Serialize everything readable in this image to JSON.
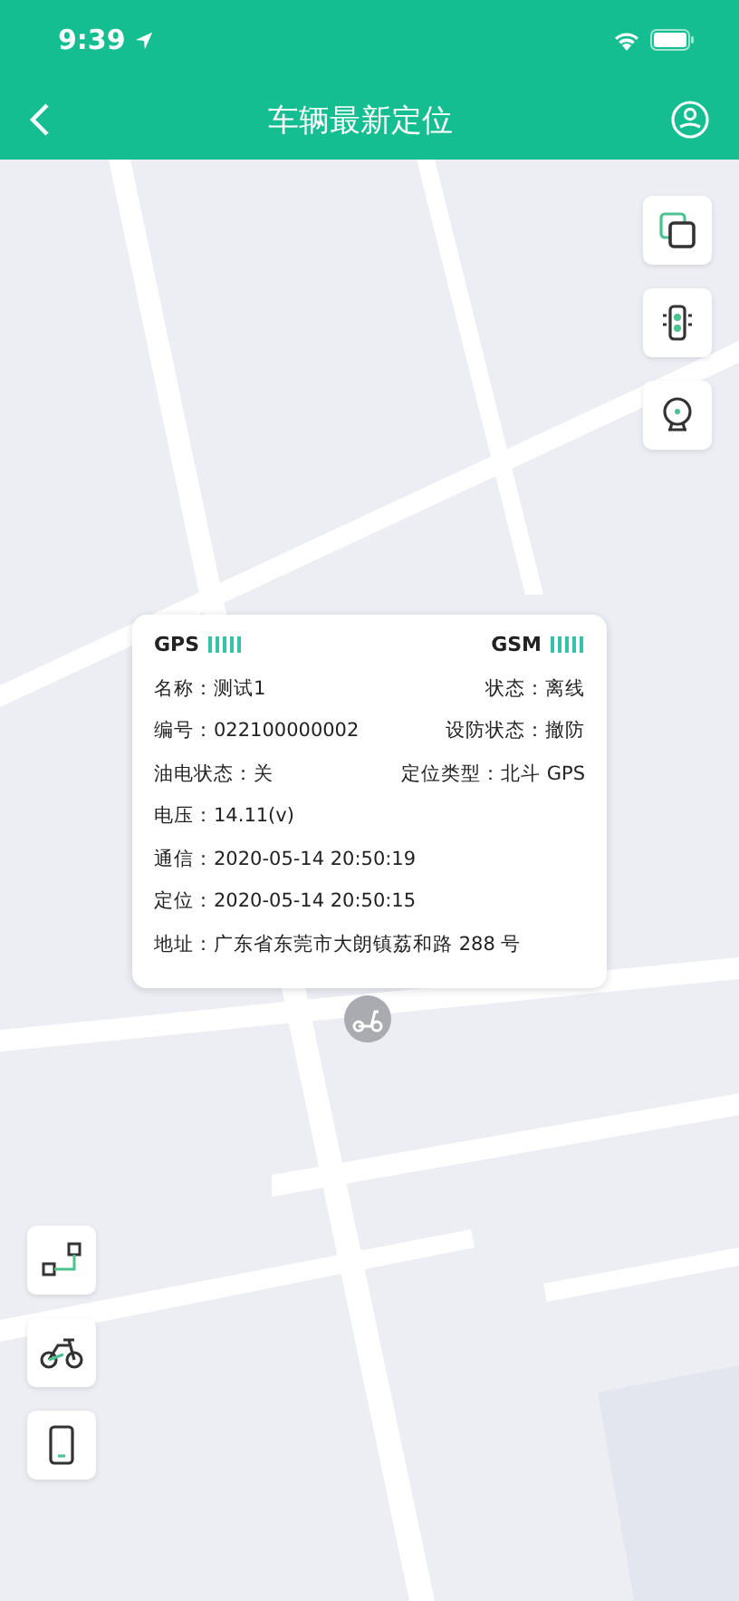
{
  "status_bar": {
    "time": "9:39"
  },
  "header": {
    "title": "车辆最新定位"
  },
  "info_card": {
    "gps_label": "GPS",
    "gsm_label": "GSM",
    "rows": [
      {
        "items": [
          {
            "label": "名称：",
            "value": "测试1"
          },
          {
            "label": "状态：",
            "value": "离线"
          }
        ]
      },
      {
        "items": [
          {
            "label": "编号：",
            "value": "022100000002"
          },
          {
            "label": "设防状态：",
            "value": "撤防"
          }
        ]
      },
      {
        "items": [
          {
            "label": "油电状态：",
            "value": "关"
          },
          {
            "label": "定位类型：",
            "value": "北斗 GPS"
          }
        ]
      },
      {
        "items": [
          {
            "label": "电压：",
            "value": "14.11(v)"
          }
        ]
      },
      {
        "items": [
          {
            "label": "通信：",
            "value": "2020-05-14 20:50:19"
          }
        ]
      },
      {
        "items": [
          {
            "label": "定位：",
            "value": "2020-05-14 20:50:15"
          }
        ]
      },
      {
        "items": [
          {
            "label": "地址：",
            "value": "广东省东莞市大朗镇荔和路 288 号"
          }
        ]
      }
    ]
  }
}
